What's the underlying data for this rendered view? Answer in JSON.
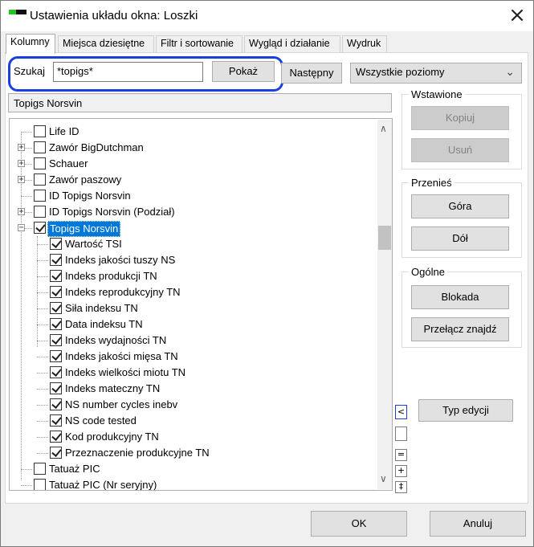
{
  "window": {
    "title": "Ustawienia układu okna: Loszki"
  },
  "tabs": [
    "Kolumny",
    "Miejsca dziesiętne",
    "Filtr i sortowanie",
    "Wygląd i działanie",
    "Wydruk"
  ],
  "search": {
    "label": "Szukaj",
    "value": "*topigs*",
    "show_button": "Pokaż",
    "next_button": "Następny",
    "highlight_color": "#1a3fe0"
  },
  "levels": {
    "selected": "Wszystkie poziomy"
  },
  "column_header": "Topigs Norsvin",
  "tree": {
    "items": [
      {
        "label": "Life ID",
        "level": 0,
        "expander": "",
        "checked": false,
        "selected": false
      },
      {
        "label": "Zawór BigDutchman",
        "level": 0,
        "expander": "+",
        "checked": false,
        "selected": false
      },
      {
        "label": "Schauer",
        "level": 0,
        "expander": "+",
        "checked": false,
        "selected": false
      },
      {
        "label": "Zawór paszowy",
        "level": 0,
        "expander": "+",
        "checked": false,
        "selected": false
      },
      {
        "label": "ID Topigs Norsvin",
        "level": 0,
        "expander": "",
        "checked": false,
        "selected": false
      },
      {
        "label": "ID Topigs Norsvin (Podział)",
        "level": 0,
        "expander": "+",
        "checked": false,
        "selected": false
      },
      {
        "label": "Topigs Norsvin",
        "level": 0,
        "expander": "−",
        "checked": true,
        "selected": true
      },
      {
        "label": "Wartość TSI",
        "level": 1,
        "expander": "",
        "checked": true,
        "selected": false
      },
      {
        "label": "Indeks jakości tuszy NS",
        "level": 1,
        "expander": "",
        "checked": true,
        "selected": false
      },
      {
        "label": "Indeks produkcji TN",
        "level": 1,
        "expander": "",
        "checked": true,
        "selected": false
      },
      {
        "label": "Indeks reprodukcyjny TN",
        "level": 1,
        "expander": "",
        "checked": true,
        "selected": false
      },
      {
        "label": "Siła indeksu TN",
        "level": 1,
        "expander": "",
        "checked": true,
        "selected": false
      },
      {
        "label": "Data indeksu TN",
        "level": 1,
        "expander": "",
        "checked": true,
        "selected": false
      },
      {
        "label": "Indeks wydajności TN",
        "level": 1,
        "expander": "",
        "checked": true,
        "selected": false
      },
      {
        "label": "Indeks jakości mięsa TN",
        "level": 1,
        "expander": "",
        "checked": true,
        "selected": false
      },
      {
        "label": "Indeks wielkości miotu TN",
        "level": 1,
        "expander": "",
        "checked": true,
        "selected": false
      },
      {
        "label": "Indeks mateczny TN",
        "level": 1,
        "expander": "",
        "checked": true,
        "selected": false
      },
      {
        "label": "NS number cycles inebv",
        "level": 1,
        "expander": "",
        "checked": true,
        "selected": false
      },
      {
        "label": "NS code tested",
        "level": 1,
        "expander": "",
        "checked": true,
        "selected": false
      },
      {
        "label": "Kod produkcyjny TN",
        "level": 1,
        "expander": "",
        "checked": true,
        "selected": false
      },
      {
        "label": "Przeznaczenie produkcyjne TN",
        "level": 1,
        "expander": "",
        "checked": true,
        "selected": false
      },
      {
        "label": "Tatuaż PIC",
        "level": 0,
        "expander": "",
        "checked": false,
        "selected": false
      },
      {
        "label": "Tatuaż PIC (Nr seryjny)",
        "level": 0,
        "expander": "",
        "checked": false,
        "selected": false
      }
    ]
  },
  "groups": {
    "inserted": {
      "title": "Wstawione",
      "copy": "Kopiuj",
      "remove": "Usuń"
    },
    "move": {
      "title": "Przenieś",
      "up": "Góra",
      "down": "Dół"
    },
    "general": {
      "title": "Ogólne",
      "lock": "Blokada",
      "toggle": "Przełącz znajdź"
    }
  },
  "edit_type_button": "Typ edycji",
  "side_buttons": {
    "collapse": "<",
    "eq": "=",
    "plus": "+",
    "updown": "‡"
  },
  "footer": {
    "ok": "OK",
    "cancel": "Anuluj"
  }
}
